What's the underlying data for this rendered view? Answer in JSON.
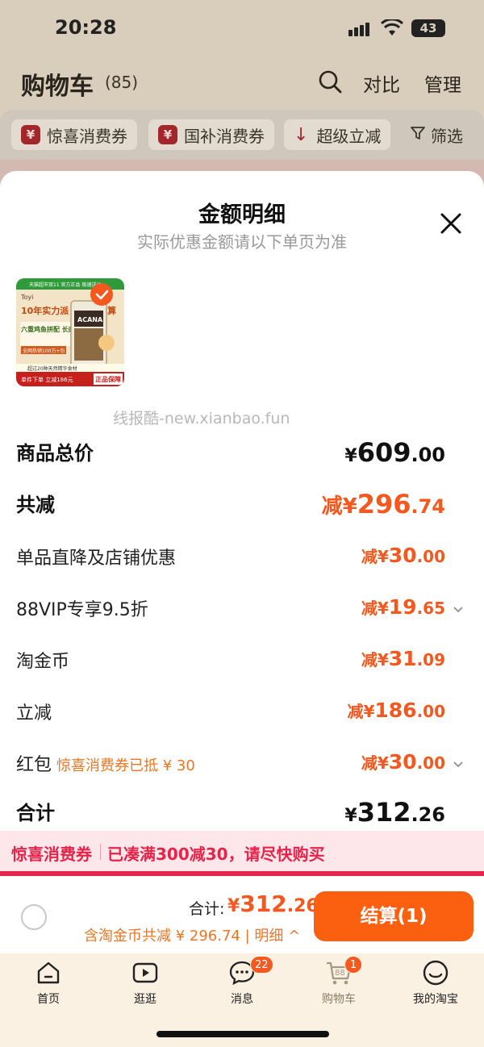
{
  "status": {
    "time": "20:28",
    "battery": "43"
  },
  "header": {
    "title": "购物车",
    "count": "(85)",
    "compare": "对比",
    "manage": "管理"
  },
  "filters": [
    {
      "mark": "¥",
      "label": "惊喜消费券"
    },
    {
      "mark": "¥",
      "label": "国补消费券"
    },
    {
      "mark": "↓",
      "label": "超级立减"
    },
    {
      "label": "筛选"
    }
  ],
  "sheet": {
    "title": "金额明细",
    "subtitle": "实际优惠金额请以下单页为准",
    "watermark": "线报酷-new.xianbao.fun",
    "product": {
      "brand_top": "天猫超市双11 官方正品 极速送达",
      "headline": "10年实力派 它们说了算",
      "tagline": "六重鸡鱼拼配 长肉不长膘",
      "sold": "全网热销100万+包",
      "note": "超过20种天然精华食材",
      "promo1": "单件下单 立减186元",
      "promo2": "正品保障",
      "logo": "Toyi",
      "bag": "ACANA"
    },
    "rows": [
      {
        "label": "商品总价",
        "value": "¥609.00",
        "yen": "¥",
        "int": "609",
        "dec": ".00",
        "bold": true,
        "color": "black"
      },
      {
        "label": "共减",
        "value": "减¥296.74",
        "prefix": "减¥",
        "int": "296",
        "dec": ".74",
        "bold": true,
        "color": "orange"
      },
      {
        "label": "单品直降及店铺优惠",
        "value": "减¥30.00",
        "prefix": "减¥",
        "int": "30",
        "dec": ".00"
      },
      {
        "label": "88VIP专享9.5折",
        "value": "减¥19.65",
        "prefix": "减¥",
        "int": "19",
        "dec": ".65",
        "chevron": true
      },
      {
        "label": "淘金币",
        "value": "减¥31.09",
        "prefix": "减¥",
        "int": "31",
        "dec": ".09"
      },
      {
        "label": "立减",
        "value": "减¥186.00",
        "prefix": "减¥",
        "int": "186",
        "dec": ".00"
      },
      {
        "label": "红包",
        "tag": "惊喜消费券已抵 ¥ 30",
        "value": "减¥30.00",
        "prefix": "减¥",
        "int": "30",
        "dec": ".00",
        "chevron": true
      },
      {
        "label": "合计",
        "value": "¥312.26",
        "yen": "¥",
        "int": "312",
        "dec": ".26",
        "bold": true,
        "color": "black"
      }
    ]
  },
  "promo": {
    "a": "惊喜消费券",
    "b": "已凑满300减30，请尽快购买"
  },
  "checkout": {
    "total_label": "合计:",
    "total_yen": "¥",
    "total_int": "312",
    "total_dec": ".26",
    "sub": "含淘金币共减 ¥ 296.74 | 明细 ^",
    "pay": "结算(1)"
  },
  "tabs": [
    {
      "label": "首页",
      "icon": "home-icon"
    },
    {
      "label": "逛逛",
      "icon": "play-icon"
    },
    {
      "label": "消息",
      "icon": "message-icon",
      "badge": "22"
    },
    {
      "label": "购物车",
      "icon": "cart-icon",
      "badge": "1",
      "cart_count": "88",
      "active": true
    },
    {
      "label": "我的淘宝",
      "icon": "profile-icon"
    }
  ],
  "colors": {
    "accent": "#f4581e",
    "pay_button": "#fb6011",
    "promo_red": "#e8234a"
  }
}
